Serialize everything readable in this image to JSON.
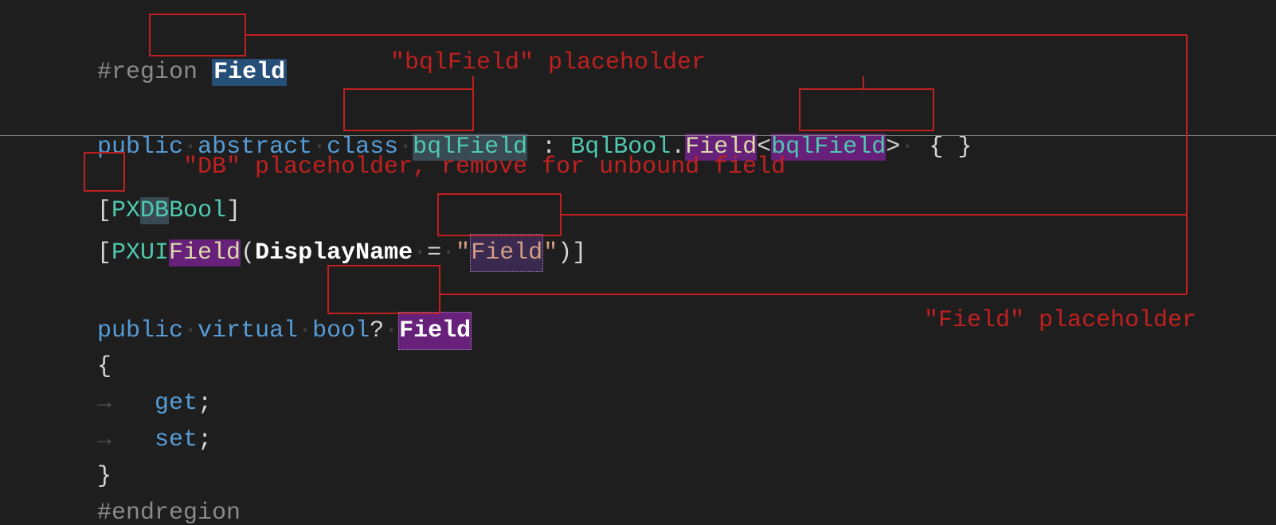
{
  "annotations": {
    "bqlField": "\"bqlField\" placeholder",
    "db": "\"DB\" placeholder, remove for unbound field",
    "field": "\"Field\" placeholder"
  },
  "code": {
    "region_directive": "#region",
    "region_name": "Field",
    "kw_public": "public",
    "kw_abstract": "abstract",
    "kw_class": "class",
    "cls_bqlField": "bqlField",
    "colon": " : ",
    "type_BqlBool": "BqlBool",
    "dot": ".",
    "member_Field": "Field",
    "lt": "<",
    "gt": ">",
    "braces_empty": " { }",
    "attr_open": "[",
    "attr_close": "]",
    "attr_PX": "PX",
    "attr_DB": "DB",
    "attr_Bool": "Bool",
    "attr_PXUI": "PXUI",
    "attr_Field": "Field",
    "paren_open": "(",
    "paren_close": ")",
    "param_DisplayName": "DisplayName",
    "equals": " = ",
    "quote": "\"",
    "string_Field": "Field",
    "kw_virtual": "virtual",
    "kw_bool": "bool",
    "nullable": "?",
    "prop_Field": "Field",
    "brace_open": "{",
    "brace_close": "}",
    "kw_get": "get",
    "kw_set": "set",
    "semi": ";",
    "endregion": "#endregion",
    "ws_arrow": "→",
    "ws_dot": "·"
  }
}
